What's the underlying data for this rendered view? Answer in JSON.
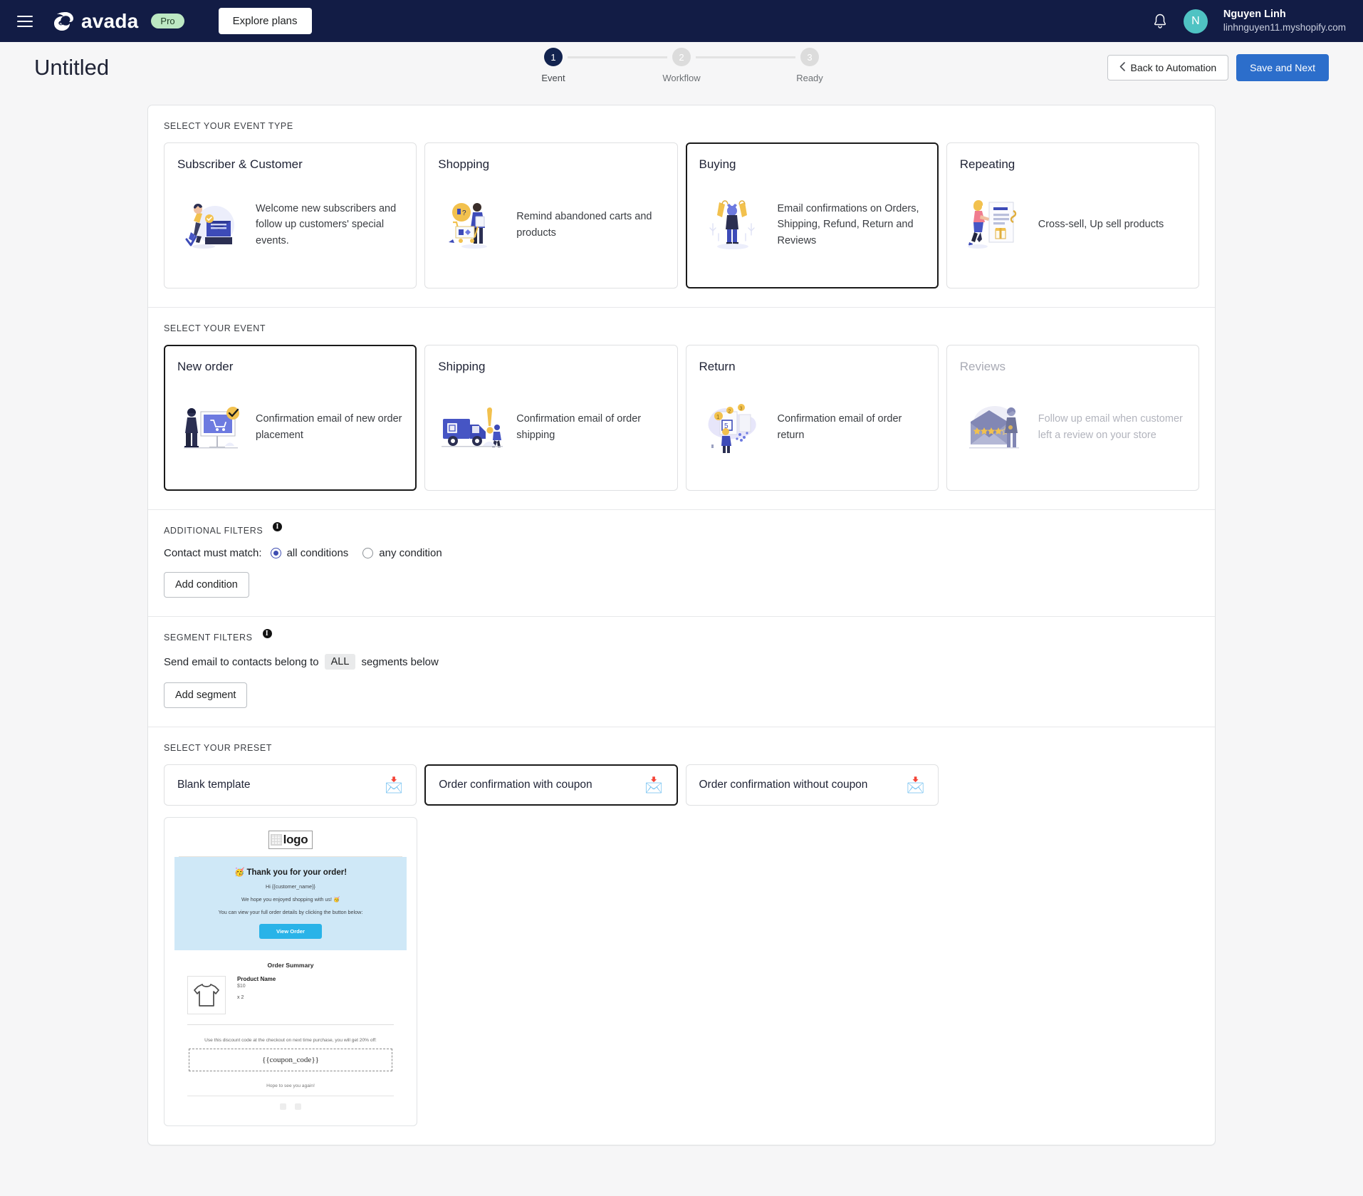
{
  "topbar": {
    "menu_icon": "hamburger-icon",
    "brand": "avada",
    "plan_badge": "Pro",
    "explore_plans": "Explore plans",
    "notification_icon": "bell-icon",
    "avatar_initial": "N",
    "user_name": "Nguyen Linh",
    "user_shop": "linhnguyen11.myshopify.com"
  },
  "header": {
    "title": "Untitled",
    "back_label": "Back to Automation",
    "save_label": "Save and Next",
    "steps": [
      {
        "number": "1",
        "label": "Event",
        "active": true
      },
      {
        "number": "2",
        "label": "Workflow",
        "active": false
      },
      {
        "number": "3",
        "label": "Ready",
        "active": false
      }
    ]
  },
  "event_type": {
    "section_title": "SELECT YOUR EVENT TYPE",
    "cards": [
      {
        "title": "Subscriber & Customer",
        "desc": "Welcome new subscribers and follow up customers' special events.",
        "selected": false,
        "icon": "subscriber-illustration"
      },
      {
        "title": "Shopping",
        "desc": "Remind abandoned carts and products",
        "selected": false,
        "icon": "shopping-cart-illustration"
      },
      {
        "title": "Buying",
        "desc": "Email confirmations on Orders, Shipping, Refund, Return and Reviews",
        "selected": true,
        "icon": "buying-bags-illustration"
      },
      {
        "title": "Repeating",
        "desc": "Cross-sell, Up sell products",
        "selected": false,
        "icon": "repeating-gift-illustration"
      }
    ]
  },
  "event": {
    "section_title": "SELECT YOUR EVENT",
    "cards": [
      {
        "title": "New order",
        "desc": "Confirmation email of new order placement",
        "selected": true,
        "disabled": false,
        "icon": "new-order-illustration"
      },
      {
        "title": "Shipping",
        "desc": "Confirmation email of order shipping",
        "selected": false,
        "disabled": false,
        "icon": "shipping-truck-illustration"
      },
      {
        "title": "Return",
        "desc": "Confirmation email of order return",
        "selected": false,
        "disabled": false,
        "icon": "return-illustration"
      },
      {
        "title": "Reviews",
        "desc": "Follow up email when customer left a review on your store",
        "selected": false,
        "disabled": true,
        "icon": "reviews-envelope-illustration"
      }
    ]
  },
  "additional_filters": {
    "section_title": "ADDITIONAL FILTERS",
    "info_icon": "info-icon",
    "match_label": "Contact must match:",
    "options": [
      {
        "label": "all conditions",
        "checked": true
      },
      {
        "label": "any condition",
        "checked": false
      }
    ],
    "add_button": "Add condition"
  },
  "segment_filters": {
    "section_title": "SEGMENT FILTERS",
    "info_icon": "info-icon",
    "text_before": "Send email to contacts belong to",
    "pill": "ALL",
    "text_after": "segments below",
    "add_button": "Add segment"
  },
  "preset": {
    "section_title": "SELECT YOUR PRESET",
    "icon": "incoming-envelope-icon",
    "cards": [
      {
        "label": "Blank template",
        "selected": false
      },
      {
        "label": "Order confirmation with coupon",
        "selected": true
      },
      {
        "label": "Order confirmation without coupon",
        "selected": false
      }
    ]
  },
  "email_preview": {
    "logo_text": "logo",
    "hero_title": "🥳 Thank you for your order!",
    "hero_lines": [
      "Hi {{customer_name}}",
      "We hope you enjoyed shopping with us! 🥳",
      "You can view your full order details by clicking the button below:"
    ],
    "cta": "View Order",
    "summary_title": "Order Summary",
    "product_name": "Product Name",
    "product_price": "$10",
    "product_qty": "x 2",
    "coupon_text": "Use this discount code at the checkout on next time purchase, you will get 20% off:",
    "coupon_code": "{{coupon_code}}",
    "footnote": "Hope to see you again!"
  },
  "colors": {
    "nav_bg": "#121c45",
    "primary": "#2c6ecb",
    "accent_teal": "#4fc3c3",
    "badge_green": "#bce8c3",
    "selected_border": "#1a1a1a",
    "radio_checked": "#3f4db1",
    "email_hero_bg": "#cfe8f7",
    "email_cta": "#29b3e8"
  }
}
